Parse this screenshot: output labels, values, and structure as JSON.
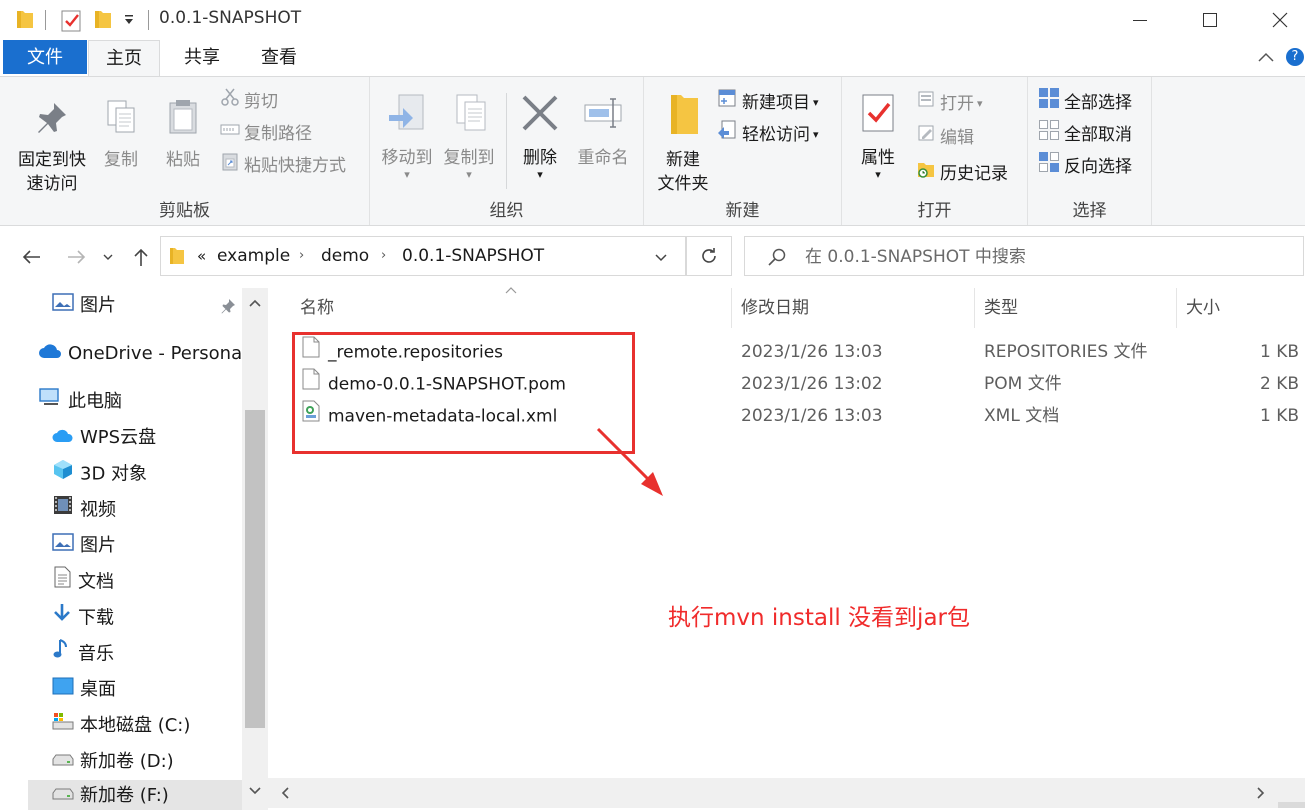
{
  "window": {
    "title": "0.0.1-SNAPSHOT"
  },
  "tabs": {
    "file": "文件",
    "home": "主页",
    "share": "共享",
    "view": "查看"
  },
  "ribbon": {
    "clipboard": {
      "label": "剪贴板",
      "pin_line1": "固定到快",
      "pin_line2": "速访问",
      "copy": "复制",
      "paste": "粘贴",
      "cut": "剪切",
      "copy_path": "复制路径",
      "paste_shortcut": "粘贴快捷方式"
    },
    "organize": {
      "label": "组织",
      "move_to": "移动到",
      "copy_to": "复制到",
      "delete": "删除",
      "rename": "重命名"
    },
    "new": {
      "label": "新建",
      "new_folder_line1": "新建",
      "new_folder_line2": "文件夹",
      "new_item": "新建项目",
      "easy_access": "轻松访问"
    },
    "open": {
      "label": "打开",
      "properties": "属性",
      "open": "打开",
      "edit": "编辑",
      "history": "历史记录"
    },
    "select": {
      "label": "选择",
      "select_all": "全部选择",
      "select_none": "全部取消",
      "invert": "反向选择"
    }
  },
  "address": {
    "prefix": "«",
    "crumbs": [
      "example",
      "demo",
      "0.0.1-SNAPSHOT"
    ],
    "search_placeholder": "在 0.0.1-SNAPSHOT 中搜索"
  },
  "nav": {
    "items": [
      {
        "label": "图片",
        "icon": "pictures-icon"
      },
      {
        "label": "OneDrive - Personal",
        "icon": "onedrive-icon"
      },
      {
        "label": "此电脑",
        "icon": "this-pc-icon"
      },
      {
        "label": "WPS云盘",
        "icon": "wps-cloud-icon"
      },
      {
        "label": "3D 对象",
        "icon": "3d-objects-icon"
      },
      {
        "label": "视频",
        "icon": "videos-icon"
      },
      {
        "label": "图片",
        "icon": "pictures-icon"
      },
      {
        "label": "文档",
        "icon": "documents-icon"
      },
      {
        "label": "下载",
        "icon": "downloads-icon"
      },
      {
        "label": "音乐",
        "icon": "music-icon"
      },
      {
        "label": "桌面",
        "icon": "desktop-icon"
      },
      {
        "label": "本地磁盘 (C:)",
        "icon": "drive-c-icon"
      },
      {
        "label": "新加卷 (D:)",
        "icon": "drive-d-icon"
      },
      {
        "label": "新加卷 (F:)",
        "icon": "drive-f-icon"
      }
    ]
  },
  "columns": {
    "name": "名称",
    "modified": "修改日期",
    "type": "类型",
    "size": "大小"
  },
  "files": [
    {
      "name": "_remote.repositories",
      "modified": "2023/1/26 13:03",
      "type": "REPOSITORIES 文件",
      "size": "1 KB",
      "icon": "blank-file-icon"
    },
    {
      "name": "demo-0.0.1-SNAPSHOT.pom",
      "modified": "2023/1/26 13:02",
      "type": "POM 文件",
      "size": "2 KB",
      "icon": "blank-file-icon"
    },
    {
      "name": "maven-metadata-local.xml",
      "modified": "2023/1/26 13:03",
      "type": "XML 文档",
      "size": "1 KB",
      "icon": "xml-file-icon"
    }
  ],
  "annotation": {
    "text": "执行mvn install  没看到jar包",
    "color": "#f02b2b"
  },
  "colors": {
    "accent": "#1a6fcf",
    "folder": "#f5c542",
    "annotation_red": "#e8312e"
  }
}
